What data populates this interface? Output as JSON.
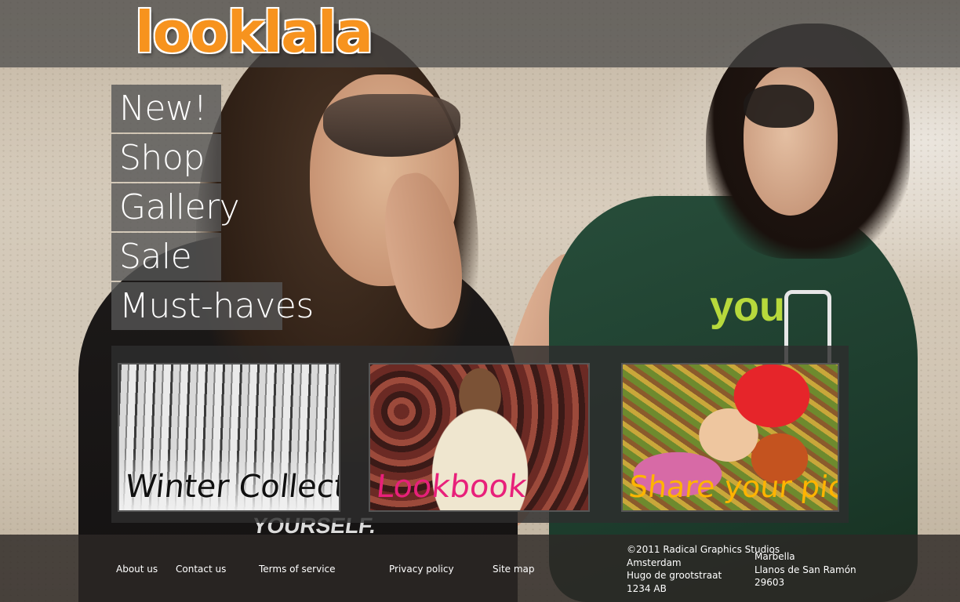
{
  "header": {
    "logo": "looklala"
  },
  "nav": {
    "items": [
      {
        "label": "New!"
      },
      {
        "label": "Shop"
      },
      {
        "label": "Gallery"
      },
      {
        "label": "Sale"
      },
      {
        "label": "Must-haves"
      }
    ]
  },
  "promos": [
    {
      "label": "Winter Collection!"
    },
    {
      "label": "Lookbook"
    },
    {
      "label": "Share your pics!"
    }
  ],
  "shirt_prints": {
    "left": "YOURSELF.",
    "right": "you"
  },
  "footer": {
    "links": [
      {
        "label": "About us"
      },
      {
        "label": "Contact us"
      },
      {
        "label": "Terms of service"
      },
      {
        "label": "Privacy policy"
      },
      {
        "label": "Site map"
      }
    ],
    "address_1": {
      "line1": "©2011 Radical Graphics Studios",
      "line2": "Amsterdam",
      "line3": "Hugo de grootstraat",
      "line4": "1234 AB"
    },
    "address_2": {
      "line1": "Marbella",
      "line2": "Llanos de San Ramón",
      "line3": "29603"
    }
  },
  "colors": {
    "logo": "#f7931e",
    "lookbook_label": "#e8207a",
    "share_label": "#ffb400",
    "header_bar": "#464646",
    "footer_bar": "#2d2826"
  }
}
